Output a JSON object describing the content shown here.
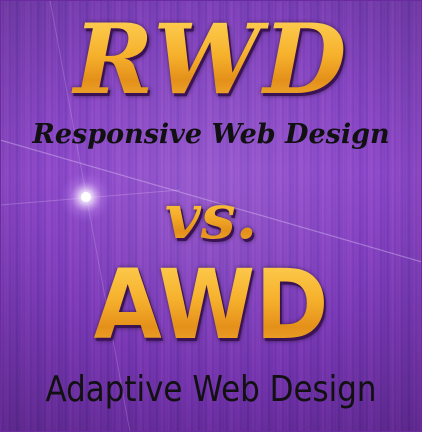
{
  "headline": {
    "primary": "RWD",
    "primary_subtitle": "Responsive Web Design",
    "connector": "vs.",
    "secondary": "AWD",
    "secondary_subtitle": "Adaptive Web Design"
  },
  "colors": {
    "background": "#7a3fb6",
    "title_gold": "#f3a51f",
    "subtitle_text": "#111111"
  }
}
